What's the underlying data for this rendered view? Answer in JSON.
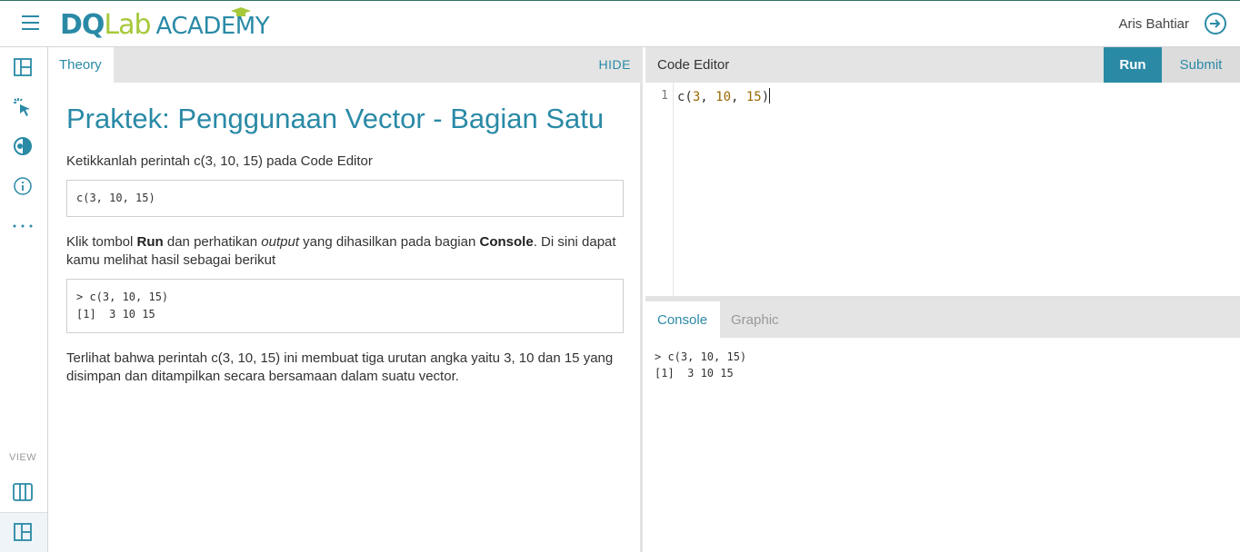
{
  "header": {
    "logo_dq": "DQ",
    "logo_lab": "Lab",
    "logo_academy": "ACADEMY",
    "username": "Aris Bahtiar",
    "menu_icon": "hamburger-icon",
    "logout_icon": "logout-icon"
  },
  "sidebar": {
    "items": [
      {
        "icon": "layout-icon"
      },
      {
        "icon": "pointer-click-icon"
      },
      {
        "icon": "contrast-icon"
      },
      {
        "icon": "info-icon"
      },
      {
        "icon": "more-dots-icon"
      }
    ],
    "view_label": "VIEW",
    "view_items": [
      {
        "icon": "columns-view-icon"
      },
      {
        "icon": "split-view-icon"
      }
    ]
  },
  "theory": {
    "tab_label": "Theory",
    "hide_label": "HIDE",
    "title": "Praktek: Penggunaan Vector - Bagian Satu",
    "para1": "Ketikkanlah perintah c(3, 10, 15) pada Code Editor",
    "code1": "c(3, 10, 15)",
    "para2_a": "Klik tombol ",
    "para2_run": "Run",
    "para2_b": " dan perhatikan ",
    "para2_output": "output",
    "para2_c": " yang dihasilkan pada bagian ",
    "para2_console": "Console",
    "para2_d": ". Di sini dapat kamu melihat hasil sebagai berikut",
    "code2": "> c(3, 10, 15)\n[1]  3 10 15",
    "para3": "Terlihat bahwa perintah c(3, 10, 15) ini membuat tiga urutan angka yaitu 3, 10 dan 15 yang disimpan dan ditampilkan secara bersamaan dalam suatu vector."
  },
  "editor": {
    "title": "Code Editor",
    "run_label": "Run",
    "submit_label": "Submit",
    "line_number": "1",
    "code_fn": "c(",
    "code_n1": "3",
    "code_sep1": ", ",
    "code_n2": "10",
    "code_sep2": ", ",
    "code_n3": "15",
    "code_close": ")"
  },
  "console": {
    "tab_console": "Console",
    "tab_graphic": "Graphic",
    "output": "> c(3, 10, 15)\n[1]  3 10 15"
  },
  "colors": {
    "accent": "#2a8aa6",
    "brand_green": "#a6c93a",
    "tab_bg": "#e4e4e4"
  }
}
